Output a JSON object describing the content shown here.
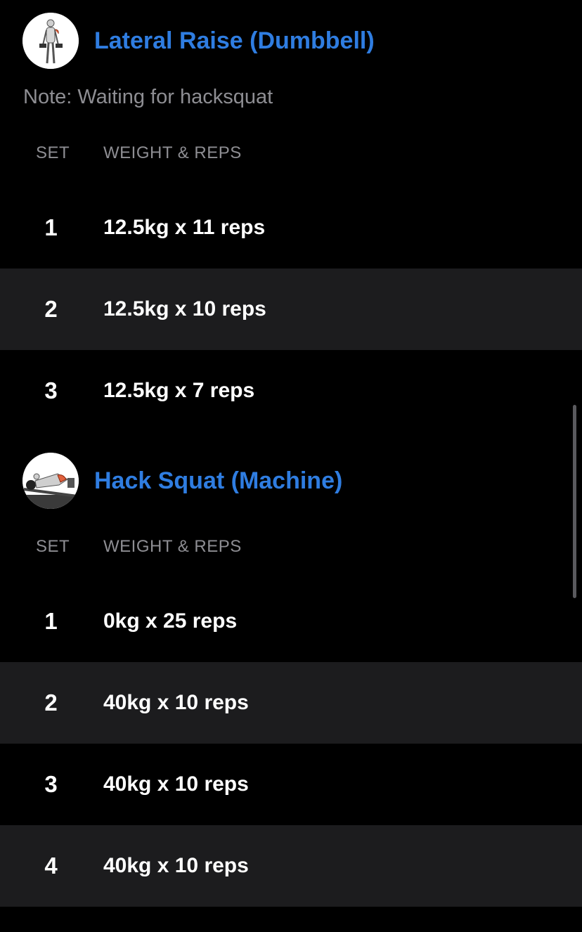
{
  "exercises": [
    {
      "title": "Lateral Raise (Dumbbell)",
      "image_icon": "lateral-raise-figure",
      "note": "Note: Waiting for hacksquat",
      "col_set": "SET",
      "col_weight_reps": "WEIGHT & REPS",
      "sets": [
        {
          "num": "1",
          "value": "12.5kg x 11 reps"
        },
        {
          "num": "2",
          "value": "12.5kg x 10 reps"
        },
        {
          "num": "3",
          "value": "12.5kg x 7 reps"
        }
      ]
    },
    {
      "title": "Hack Squat (Machine)",
      "image_icon": "hack-squat-figure",
      "col_set": "SET",
      "col_weight_reps": "WEIGHT & REPS",
      "sets": [
        {
          "num": "1",
          "value": "0kg x 25 reps"
        },
        {
          "num": "2",
          "value": "40kg x 10 reps"
        },
        {
          "num": "3",
          "value": "40kg x 10 reps"
        },
        {
          "num": "4",
          "value": "40kg x 10 reps"
        }
      ]
    }
  ],
  "colors": {
    "background": "#000000",
    "alt_row": "#1c1c1e",
    "accent": "#2f7de1",
    "muted": "#8e8e93"
  }
}
